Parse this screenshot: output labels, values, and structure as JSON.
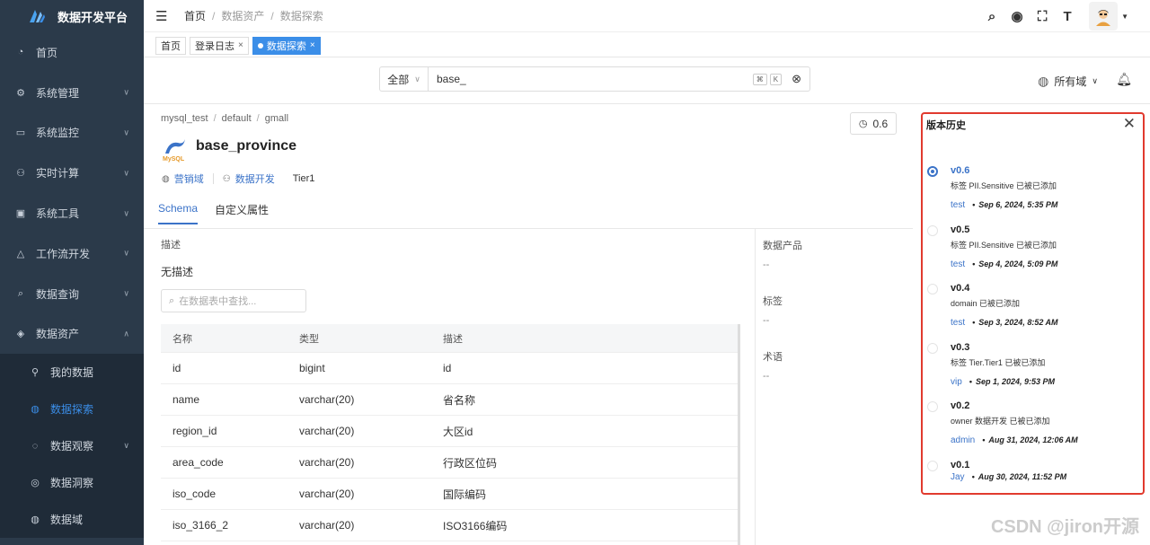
{
  "app": {
    "title": "数据开发平台"
  },
  "sidebar": {
    "items": [
      {
        "label": "首页",
        "icon": "dashboard-icon",
        "glyph": "◔",
        "has_chevron": false
      },
      {
        "label": "系统管理",
        "icon": "gear-icon",
        "glyph": "⚙",
        "has_chevron": true
      },
      {
        "label": "系统监控",
        "icon": "monitor-icon",
        "glyph": "▭",
        "has_chevron": true
      },
      {
        "label": "实时计算",
        "icon": "cluster-icon",
        "glyph": "⚇",
        "has_chevron": true
      },
      {
        "label": "系统工具",
        "icon": "toolbox-icon",
        "glyph": "▣",
        "has_chevron": true
      },
      {
        "label": "工作流开发",
        "icon": "workflow-icon",
        "glyph": "△",
        "has_chevron": true
      },
      {
        "label": "数据查询",
        "icon": "search-icon",
        "glyph": "⌕",
        "has_chevron": true
      },
      {
        "label": "数据资产",
        "icon": "asset-icon",
        "glyph": "◈",
        "has_chevron": true,
        "expanded": true
      }
    ],
    "sub_items": [
      {
        "label": "我的数据",
        "icon": "user-data-icon",
        "glyph": "⚲",
        "active": false,
        "has_chevron": false
      },
      {
        "label": "数据探索",
        "icon": "globe-icon",
        "glyph": "◍",
        "active": true,
        "has_chevron": false
      },
      {
        "label": "数据观察",
        "icon": "observe-icon",
        "glyph": "◌",
        "active": false,
        "has_chevron": true
      },
      {
        "label": "数据洞察",
        "icon": "insight-icon",
        "glyph": "◎",
        "active": false,
        "has_chevron": false
      },
      {
        "label": "数据域",
        "icon": "domain-icon",
        "glyph": "◍",
        "active": false,
        "has_chevron": false
      }
    ]
  },
  "header": {
    "breadcrumb": [
      "首页",
      "数据资产",
      "数据探索"
    ]
  },
  "page_tabs": [
    {
      "label": "首页",
      "closable": false,
      "active": false
    },
    {
      "label": "登录日志",
      "closable": true,
      "active": false
    },
    {
      "label": "数据探索",
      "closable": true,
      "active": true
    }
  ],
  "search": {
    "scope": "全部",
    "value": "base_",
    "shortcut_keys": [
      "⌘",
      "K"
    ],
    "domain": "所有域"
  },
  "table": {
    "path": [
      "mysql_test",
      "default",
      "gmall"
    ],
    "name": "base_province",
    "version_button": "0.6",
    "domain": "营销域",
    "owner_team": "数据开发",
    "tier": "Tier1",
    "tabs": [
      "Schema",
      "自定义属性"
    ],
    "active_tab": "Schema",
    "desc_label": "描述",
    "desc_value": "无描述",
    "column_search_placeholder": "在数据表中查找...",
    "columns_header": [
      "名称",
      "类型",
      "描述"
    ],
    "columns": [
      [
        "id",
        "bigint",
        "id"
      ],
      [
        "name",
        "varchar(20)",
        "省名称"
      ],
      [
        "region_id",
        "varchar(20)",
        "大区id"
      ],
      [
        "area_code",
        "varchar(20)",
        "行政区位码"
      ],
      [
        "iso_code",
        "varchar(20)",
        "国际编码"
      ],
      [
        "iso_3166_2",
        "varchar(20)",
        "ISO3166编码"
      ]
    ]
  },
  "side_meta": [
    {
      "label": "数据产品",
      "value": "--"
    },
    {
      "label": "标签",
      "value": "--"
    },
    {
      "label": "术语",
      "value": "--"
    }
  ],
  "version_history": {
    "title": "版本历史",
    "entries": [
      {
        "version": "v0.6",
        "desc": "标签 PII.Sensitive 已被已添加",
        "user": "test",
        "date": "Sep 6, 2024, 5:35 PM",
        "selected": true
      },
      {
        "version": "v0.5",
        "desc": "标签 PII.Sensitive 已被已添加",
        "user": "test",
        "date": "Sep 4, 2024, 5:09 PM",
        "selected": false
      },
      {
        "version": "v0.4",
        "desc": "domain 已被已添加",
        "user": "test",
        "date": "Sep 3, 2024, 8:52 AM",
        "selected": false
      },
      {
        "version": "v0.3",
        "desc": "标签 Tier.Tier1 已被已添加",
        "user": "vip",
        "date": "Sep 1, 2024, 9:53 PM",
        "selected": false
      },
      {
        "version": "v0.2",
        "desc": "owner 数据开发 已被已添加",
        "user": "admin",
        "date": "Aug 31, 2024, 12:06 AM",
        "selected": false
      },
      {
        "version": "v0.1",
        "desc": "",
        "user": "Jay",
        "date": "Aug 30, 2024, 11:52 PM",
        "selected": false
      }
    ]
  },
  "watermark": "CSDN @jiron开源",
  "colors": {
    "accent": "#3b73c8",
    "sidebar_bg": "#2b3a4a",
    "highlight_border": "#e13a2e"
  }
}
